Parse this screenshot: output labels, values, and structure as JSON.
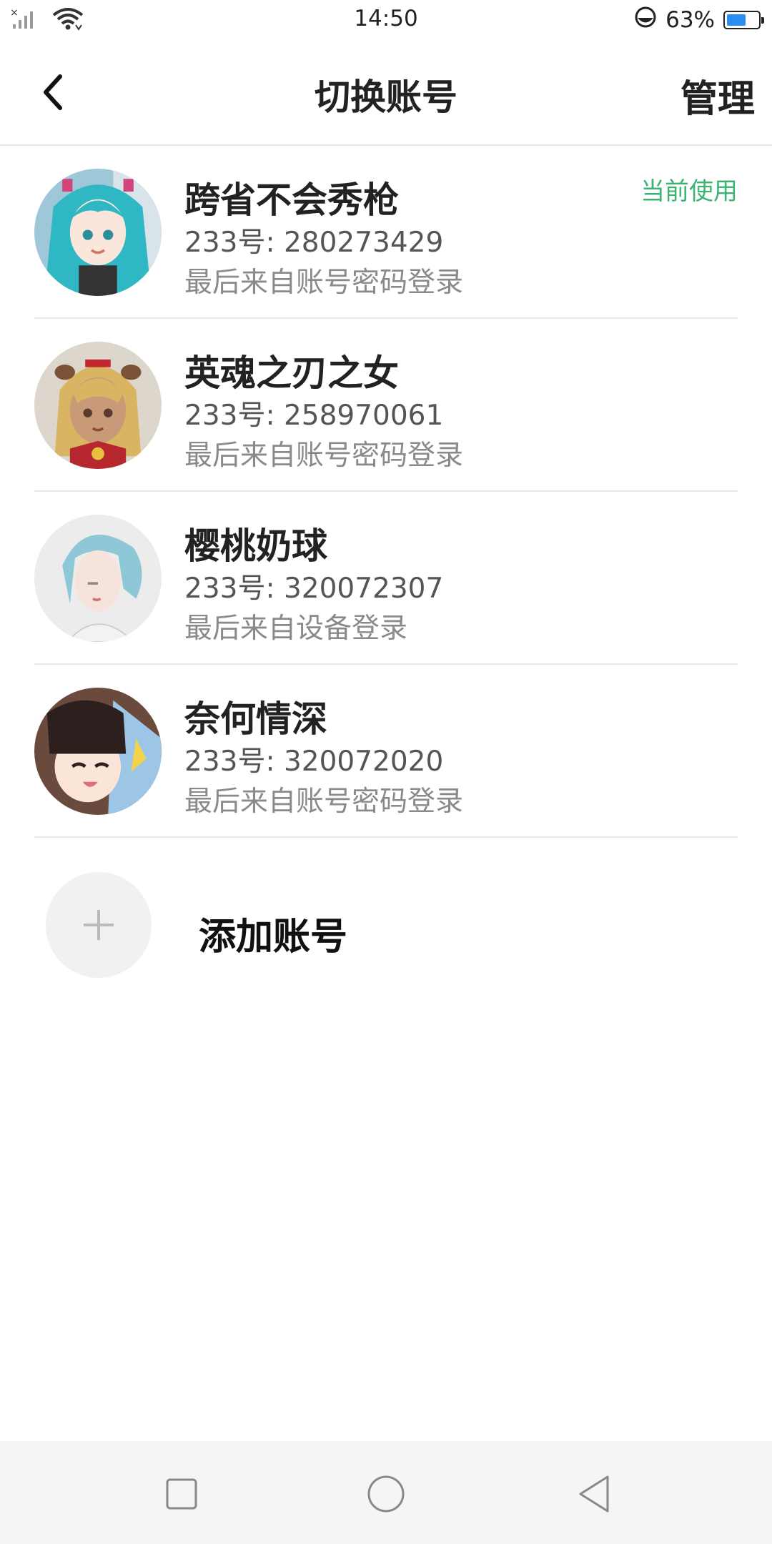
{
  "status_bar": {
    "time": "14:50",
    "battery_text": "63%",
    "battery_level": 0.63,
    "icons": [
      "no-sim-signal-icon",
      "wifi-icon",
      "eye-comfort-icon",
      "battery-icon"
    ]
  },
  "header": {
    "title": "切换账号",
    "manage_label": "管理",
    "back_icon": "back-arrow-icon"
  },
  "accounts": [
    {
      "name": "跨省不会秀枪",
      "uid": "233号: 280273429",
      "login_via": "最后来自账号密码登录",
      "badge": "当前使用"
    },
    {
      "name": "英魂之刃之女",
      "uid": "233号: 258970061",
      "login_via": "最后来自账号密码登录",
      "badge": ""
    },
    {
      "name": "樱桃奶球",
      "uid": "233号: 320072307",
      "login_via": "最后来自设备登录",
      "badge": ""
    },
    {
      "name": "奈何情深",
      "uid": "233号: 320072020",
      "login_via": "最后来自账号密码登录",
      "badge": ""
    }
  ],
  "add_account": {
    "label": "添加账号",
    "icon": "plus-icon"
  },
  "nav_bar": {
    "icons": [
      "recents-square-icon",
      "home-circle-icon",
      "back-triangle-icon"
    ]
  },
  "colors": {
    "accent_green": "#3cb371",
    "battery_blue": "#2d8cf0"
  }
}
